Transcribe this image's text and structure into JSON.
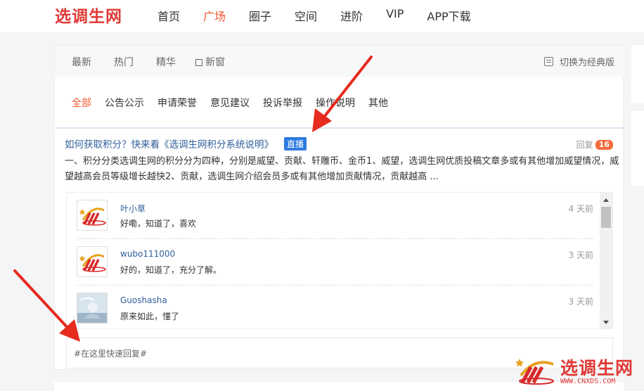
{
  "site": {
    "logo": "选调生网"
  },
  "nav": [
    "首页",
    "广场",
    "圈子",
    "空间",
    "进阶",
    "VIP",
    "APP下载"
  ],
  "nav_active": 1,
  "filter_tabs": {
    "newest": "最新",
    "hot": "热门",
    "featured": "精华",
    "new_window": "新窗"
  },
  "switch_classic": "切换为经典版",
  "categories": [
    "全部",
    "公告公示",
    "申请荣誉",
    "意见建议",
    "投诉举报",
    "操作说明",
    "其他"
  ],
  "category_active": 0,
  "post": {
    "title": "如何获取积分？快来看《选调生网积分系统说明》",
    "badge": "直播",
    "reply_label": "回复",
    "reply_count": "16",
    "excerpt": "一、积分分类选调生网的积分分为四种，分别是威望、贡献、轩雕币、金币1、威望，选调生网优质投稿文章多或有其他增加威望情况，威望越高会员等级增长越快2、贡献，选调生网介绍会员多或有其他增加贡献情况，贡献越高 ..."
  },
  "replies": [
    {
      "name": "叶小草",
      "text": "好嘞，知道了，喜欢",
      "time": "4 天前"
    },
    {
      "name": "wubo111000",
      "text": "好的，知道了，充分了解。",
      "time": "3 天前"
    },
    {
      "name": "Guoshasha",
      "text": "原来如此，懂了",
      "time": "3 天前"
    }
  ],
  "quick_reply_placeholder": "#在这里快速回复#",
  "watermark": {
    "text": "选调生网",
    "url": "WWW.CNXDS.COM"
  },
  "colors": {
    "accent": "#f0562e",
    "link": "#2f5f9b",
    "badge": "#2f7ae0",
    "brand": "#e03a36",
    "arrow": "#e62b1f"
  }
}
